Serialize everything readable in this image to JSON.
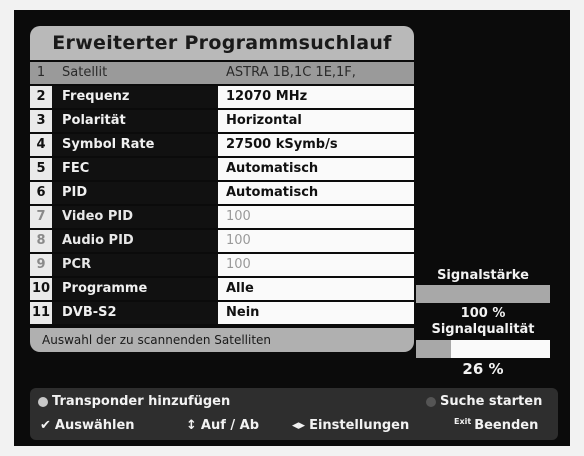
{
  "title": "Erweiterter Programmsuchlauf",
  "rows": [
    {
      "num": "1",
      "label": "Satellit",
      "value": "ASTRA 1B,1C 1E,1F,"
    },
    {
      "num": "2",
      "label": "Frequenz",
      "value": "12070 MHz"
    },
    {
      "num": "3",
      "label": "Polarität",
      "value": "Horizontal"
    },
    {
      "num": "4",
      "label": "Symbol Rate",
      "value": "27500 kSymb/s"
    },
    {
      "num": "5",
      "label": "FEC",
      "value": "Automatisch"
    },
    {
      "num": "6",
      "label": "PID",
      "value": "Automatisch"
    },
    {
      "num": "7",
      "label": "Video PID",
      "value": "100"
    },
    {
      "num": "8",
      "label": "Audio PID",
      "value": "100"
    },
    {
      "num": "9",
      "label": "PCR",
      "value": "100"
    },
    {
      "num": "10",
      "label": "Programme",
      "value": "Alle"
    },
    {
      "num": "11",
      "label": "DVB-S2",
      "value": "Nein"
    }
  ],
  "hint": "Auswahl der zu scannenden Satelliten",
  "meters": {
    "strength_label": "Signalstärke",
    "strength_value": "100 %",
    "strength_level": 1.0,
    "quality_label": "Signalqualität",
    "quality_value": "26 %",
    "quality_level": 0.26
  },
  "footer": {
    "add_transponder": "Transponder hinzufügen",
    "start_search": "Suche starten",
    "select": "Auswählen",
    "up_down": "Auf / Ab",
    "settings": "Einstellungen",
    "exit_key": "Exit",
    "quit": "Beenden"
  },
  "colors": {
    "red_key": "#c8c8c8",
    "green_key": "#555555"
  }
}
